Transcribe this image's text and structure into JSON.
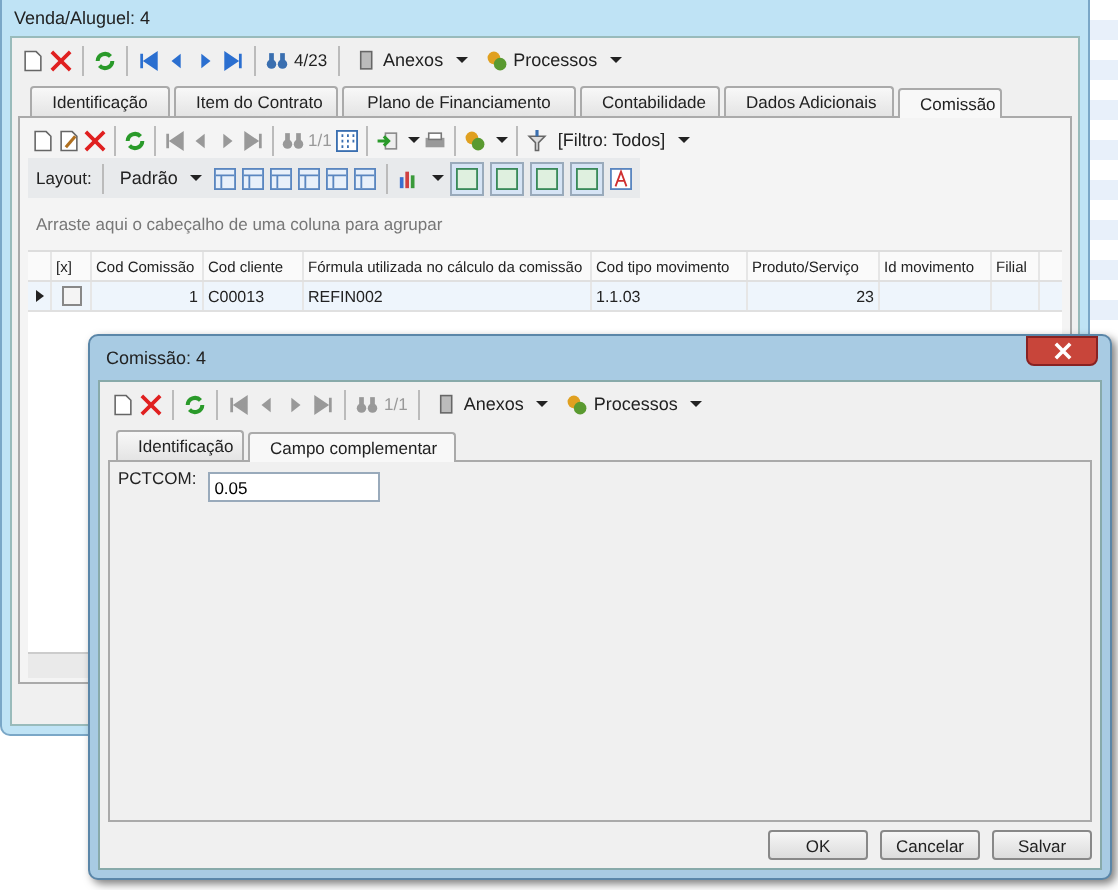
{
  "main_window": {
    "title": "Venda/Aluguel: 4",
    "toolbar": {
      "record_counter": "4/23",
      "attachments": "Anexos",
      "processes": "Processos"
    },
    "tabs": [
      {
        "label": "Identificação",
        "selected": false
      },
      {
        "label": "Item do Contrato",
        "selected": false
      },
      {
        "label": "Plano de Financiamento",
        "selected": false
      },
      {
        "label": "Contabilidade",
        "selected": false
      },
      {
        "label": "Dados Adicionais",
        "selected": false
      },
      {
        "label": "Comissão",
        "selected": true
      }
    ],
    "sub_toolbar": {
      "record_counter": "1/1",
      "filter": "[Filtro: Todos]"
    },
    "layout_bar": {
      "label": "Layout:",
      "preset": "Padrão"
    },
    "group_hint": "Arraste aqui o cabeçalho de uma coluna para agrupar",
    "table": {
      "columns": [
        "[x]",
        "Cod Comissão",
        "Cod cliente",
        "Fórmula utilizada no cálculo da comissão",
        "Cod tipo movimento",
        "Produto/Serviço",
        "Id movimento",
        "Filial"
      ],
      "rows": [
        {
          "current": true,
          "checked": false,
          "cells": [
            "",
            "1",
            "C00013",
            "REFIN002",
            "1.1.03",
            "23",
            "",
            ""
          ]
        }
      ]
    }
  },
  "dialog": {
    "title": "Comissão: 4",
    "toolbar": {
      "record_counter": "1/1",
      "attachments": "Anexos",
      "processes": "Processos"
    },
    "tabs": [
      {
        "label": "Identificação",
        "selected": false
      },
      {
        "label": "Campo complementar",
        "selected": true
      }
    ],
    "field": {
      "label": "PCTCOM:",
      "value": "0.05"
    },
    "buttons": [
      "OK",
      "Cancelar",
      "Salvar"
    ]
  }
}
